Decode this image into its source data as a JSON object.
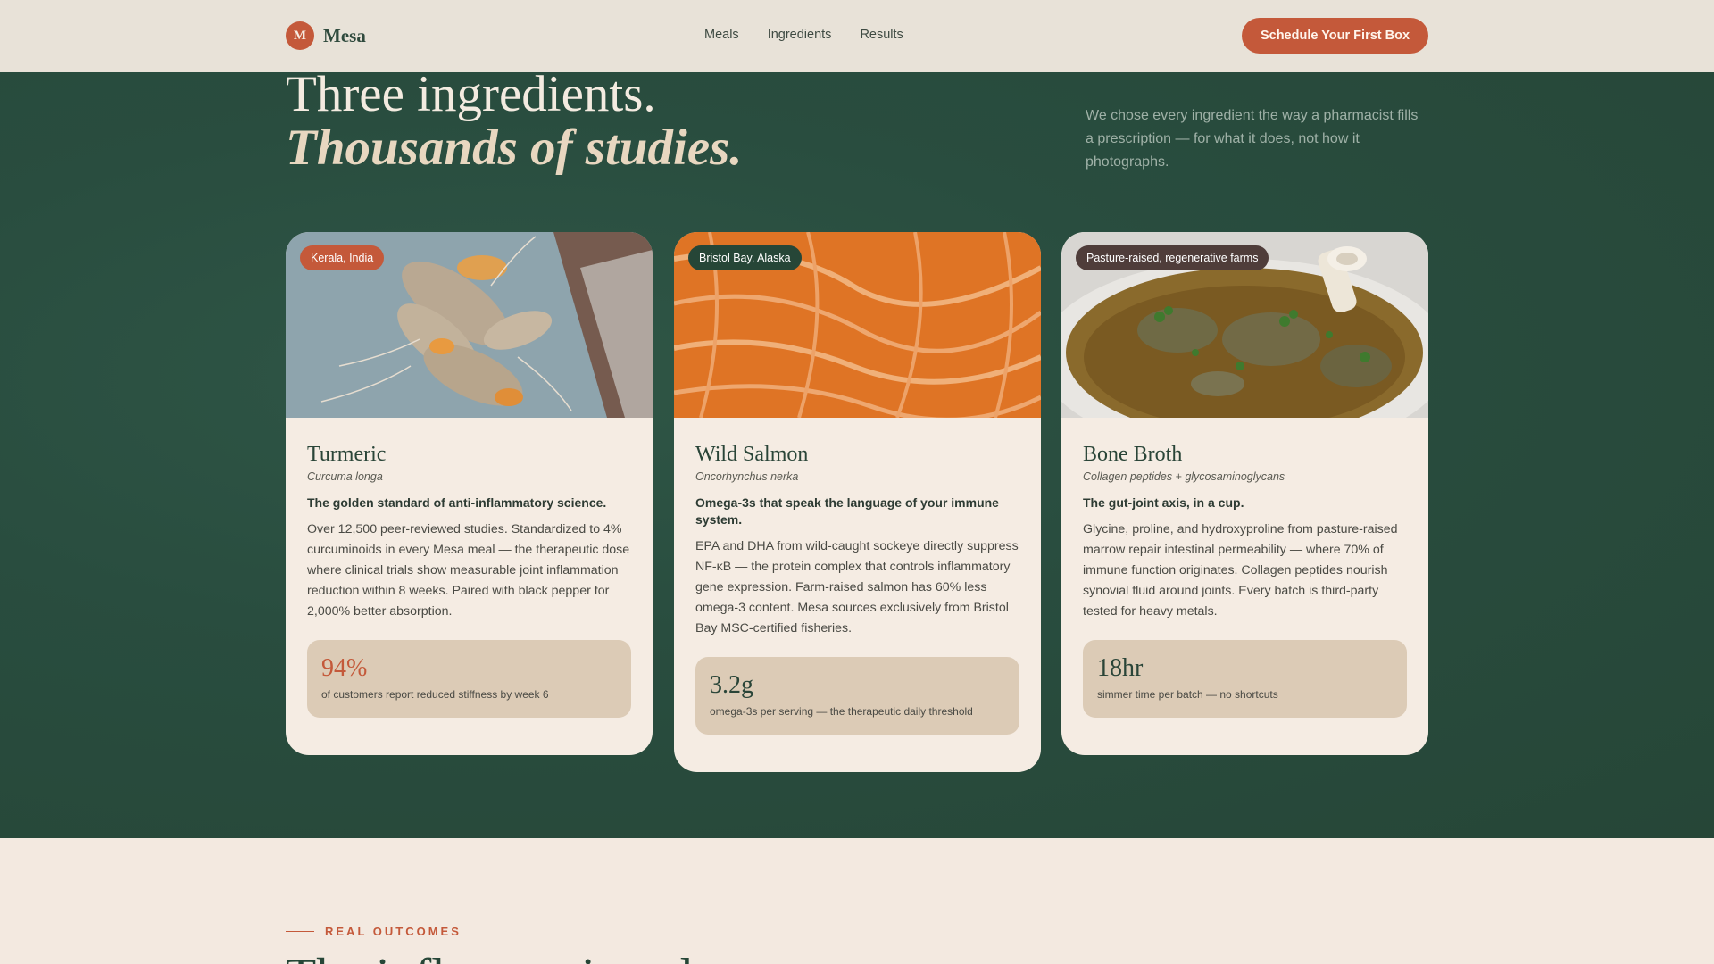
{
  "brand": {
    "mark": "M",
    "name": "Mesa"
  },
  "nav": {
    "items": [
      "Meals",
      "Ingredients",
      "Results"
    ]
  },
  "cta": {
    "label": "Schedule Your First Box"
  },
  "hero": {
    "line1": "Three ingredients.",
    "line2": "Thousands of studies.",
    "description": "We chose every ingredient the way a pharmacist fills a prescription — for what it does, not how it photographs."
  },
  "cards": [
    {
      "badge": "Kerala, India",
      "badge_color": "#c4593a",
      "title": "Turmeric",
      "scientific": "Curcuma longa",
      "lead": "The golden standard of anti-inflammatory science.",
      "text": "Over 12,500 peer-reviewed studies. Standardized to 4% curcuminoids in every Mesa meal — the therapeutic dose where clinical trials show measurable joint inflammation reduction within 8 weeks. Paired with black pepper for 2,000% better absorption.",
      "stat_value": "94%",
      "stat_color": "#c4593a",
      "stat_caption": "of customers report reduced stiffness by week 6"
    },
    {
      "badge": "Bristol Bay, Alaska",
      "badge_color": "#264637",
      "title": "Wild Salmon",
      "scientific": "Oncorhynchus nerka",
      "lead": "Omega-3s that speak the language of your immune system.",
      "text": "EPA and DHA from wild-caught sockeye directly suppress NF-κB — the protein complex that controls inflammatory gene expression. Farm-raised salmon has 60% less omega-3 content. Mesa sources exclusively from Bristol Bay MSC-certified fisheries.",
      "stat_value": "3.2g",
      "stat_color": "#2a4538",
      "stat_caption": "omega-3s per serving — the therapeutic daily threshold"
    },
    {
      "badge": "Pasture-raised, regenerative farms",
      "badge_color": "#4f3d3a",
      "title": "Bone Broth",
      "scientific": "Collagen peptides + glycosaminoglycans",
      "lead": "The gut-joint axis, in a cup.",
      "text": "Glycine, proline, and hydroxyproline from pasture-raised marrow repair intestinal permeability — where 70% of immune function originates. Collagen peptides nourish synovial fluid around joints. Every batch is third-party tested for heavy metals.",
      "stat_value": "18hr",
      "stat_color": "#2a4538",
      "stat_caption": "simmer time per batch — no shortcuts"
    }
  ],
  "outcomes": {
    "label": "REAL OUTCOMES",
    "heading": "The inflammation eleva"
  },
  "colors": {
    "accent": "#c4593a",
    "forest": "#264637",
    "cream": "#f3e9e0",
    "sand": "#dccbb6"
  }
}
